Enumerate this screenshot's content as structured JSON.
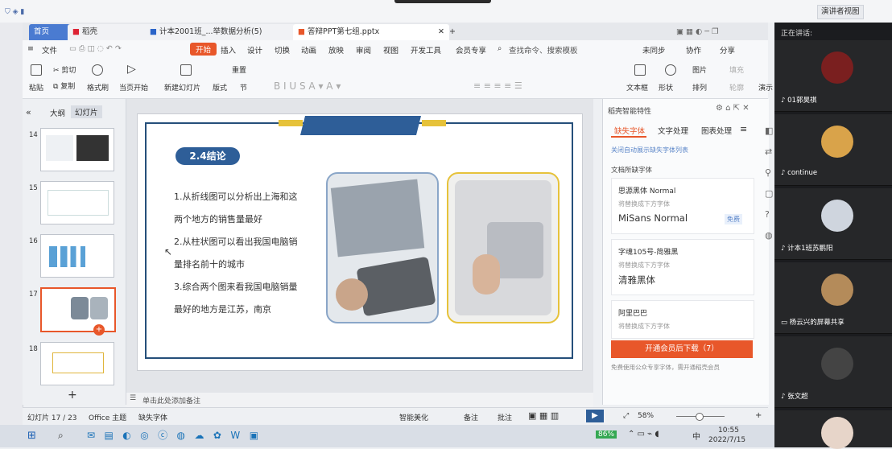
{
  "topbar": {
    "presenter_view": "演讲者视图"
  },
  "tabs": [
    {
      "label": "首页"
    },
    {
      "label": "稻壳"
    },
    {
      "label": "计本2001班_...举数据分析(5)"
    },
    {
      "label": "答辩PPT第七组.pptx"
    }
  ],
  "menu": {
    "file": "文件",
    "items": [
      "开始",
      "插入",
      "设计",
      "切换",
      "动画",
      "放映",
      "审阅",
      "视图",
      "开发工具",
      "会员专享"
    ],
    "search": "查找命令、搜索模板",
    "unsynced": "未同步",
    "collab": "协作",
    "share": "分享"
  },
  "ribbon": {
    "paste": "粘贴",
    "cut": "剪切",
    "copy": "复制",
    "format_painter": "格式刷",
    "from_current": "当页开始",
    "new_slide": "新建幻灯片",
    "layout": "版式",
    "section": "节",
    "reset": "重置",
    "textbox": "文本框",
    "shape": "形状",
    "arrange": "排列",
    "picture": "图片",
    "fill": "填充",
    "outline": "轮廓",
    "play": "演示"
  },
  "panel": {
    "tab_outline": "大纲",
    "tab_slides": "幻灯片",
    "slide_numbers": [
      "14",
      "15",
      "16",
      "17",
      "18"
    ],
    "add": "+"
  },
  "slide": {
    "title": "2.4结论",
    "lines": [
      "1.从折线图可以分析出上海和这",
      "两个地方的销售量最好",
      "2.从柱状图可以看出我国电脑销",
      "量排名前十的城市",
      "3.综合两个图来看我国电脑销量",
      "最好的地方是江苏，南京"
    ]
  },
  "right_panel": {
    "header": "稻壳智能特性",
    "tabs": [
      "缺失字体",
      "文字处理",
      "图表处理"
    ],
    "toggle": "关闭自动展示缺失字体列表",
    "section": "文档所缺字体",
    "fonts": [
      {
        "missing": "思源黑体 Normal",
        "hint": "将替换成下方字体",
        "replace": "MiSans Normal",
        "badge": "免费"
      },
      {
        "missing": "字魂105号-简雅黑",
        "hint": "将替换成下方字体",
        "replace": "清雅黑体"
      },
      {
        "missing": "阿里巴巴",
        "hint": "将替换成下方字体",
        "replace": ""
      }
    ],
    "download_btn": "开通会员后下载（7）",
    "note": "免费使用公众专享字体，需开通稻壳会员"
  },
  "notes": {
    "placeholder": "单击此处添加备注"
  },
  "status": {
    "slide_counter": "幻灯片 17 / 23",
    "theme": "Office 主题",
    "missing_font": "缺失字体",
    "beautify": "智能美化",
    "notes": "备注",
    "comments": "批注",
    "zoom": "58%"
  },
  "taskbar": {
    "battery": "86%",
    "ime": "中",
    "time": "10:55",
    "date": "2022/7/15"
  },
  "meeting": {
    "speaking_label": "正在讲话:",
    "participants": [
      {
        "name": "01郭昊祺"
      },
      {
        "name": "continue"
      },
      {
        "name": "计本1班苏鹏阳"
      },
      {
        "name": "杨云兴的屏幕共享"
      },
      {
        "name": "张文超"
      },
      {
        "name": ""
      }
    ]
  },
  "colors": {
    "accent": "#2e5e98",
    "ribbon_active": "#e8572a",
    "slide_border": "#254f7a",
    "download": "#e8572a"
  }
}
